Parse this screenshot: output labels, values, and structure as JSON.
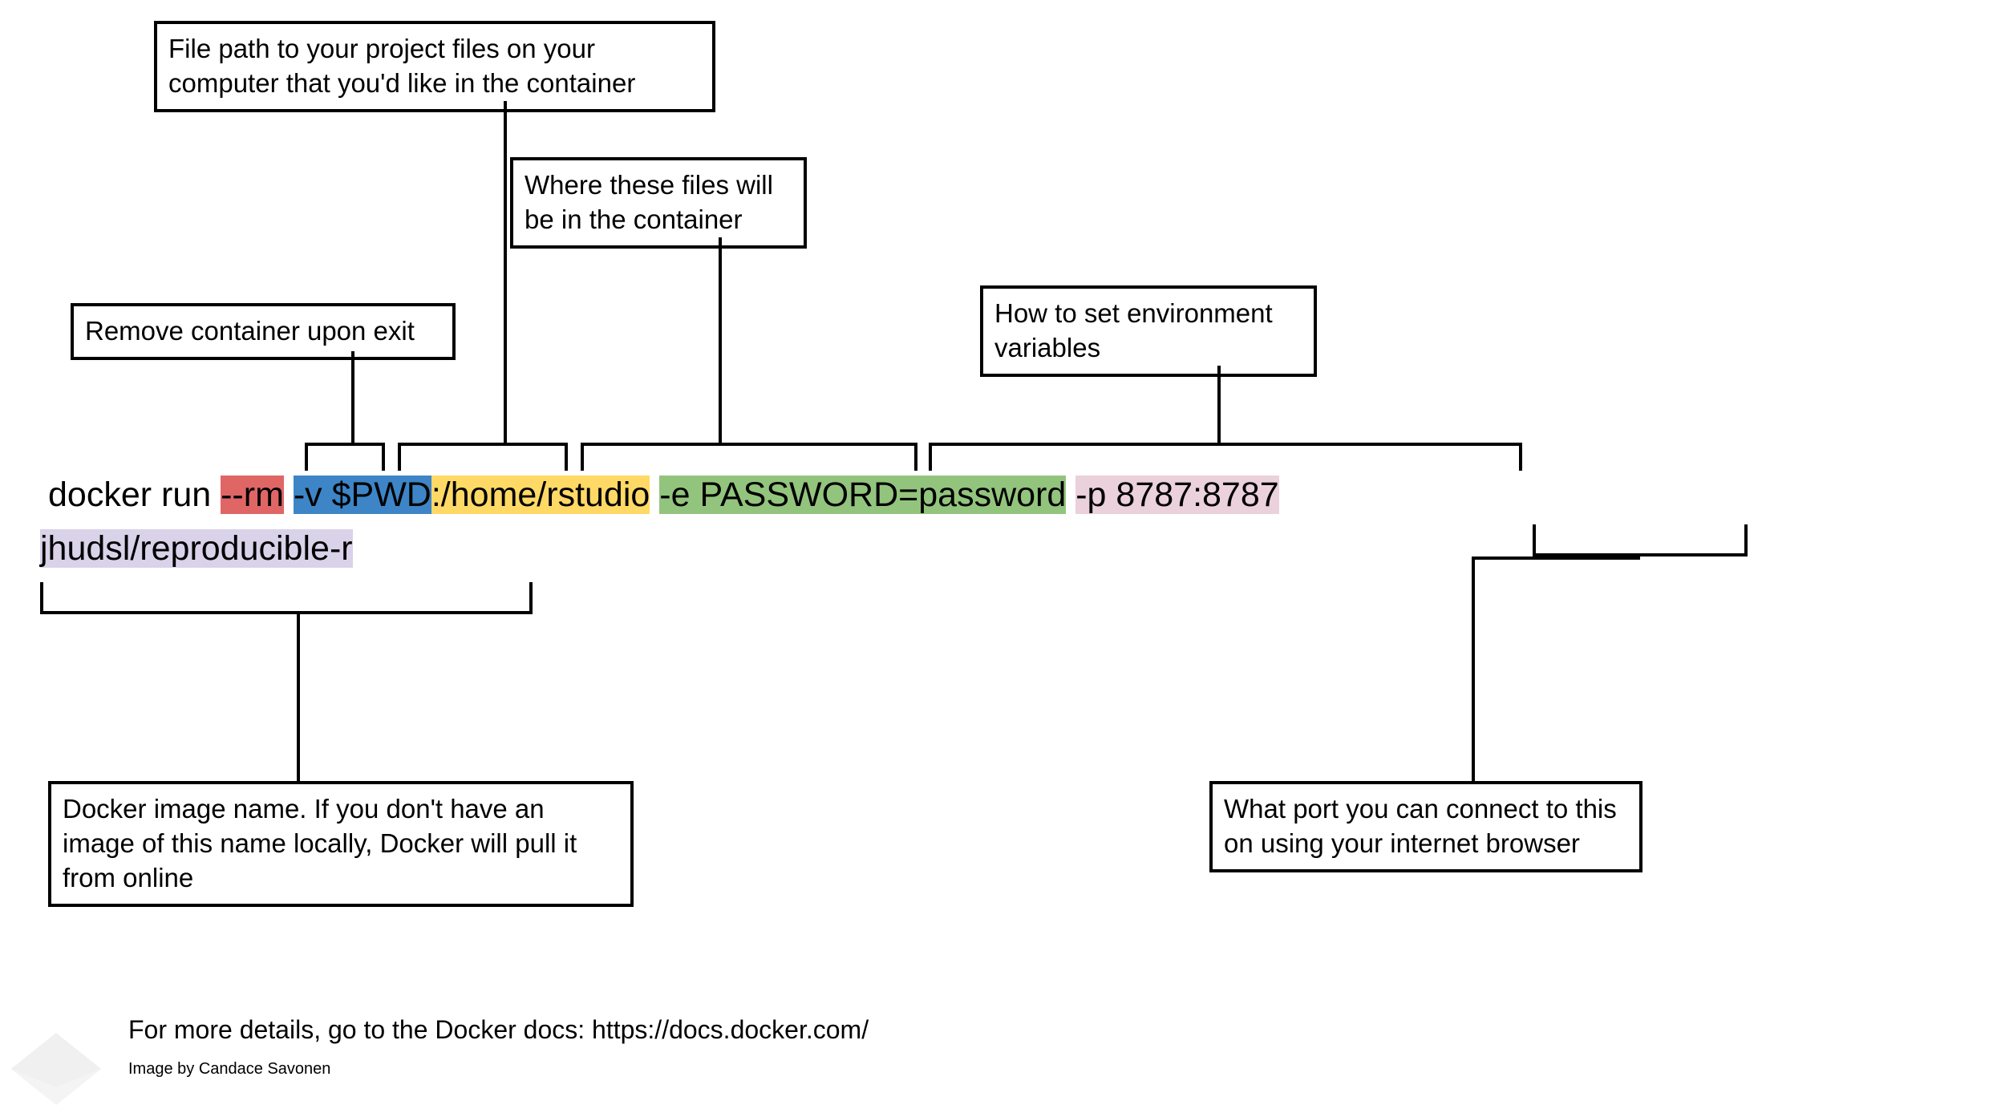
{
  "labels": {
    "filepath": "File path to your project files on your computer that you'd like in the container",
    "where": "Where these files will be in the container",
    "remove": "Remove container upon exit",
    "env": "How to set environment variables",
    "image": "Docker image name. If you don't have an image of this name locally, Docker will pull it from online",
    "port": "What port you can connect to this on using your internet browser"
  },
  "command": {
    "prefix": "docker run ",
    "rm": "--rm",
    "space1": " ",
    "vol_src": "-v $PWD",
    "vol_sep": ":",
    "vol_dst": "/home/rstudio",
    "space2": " ",
    "env": "-e PASSWORD=password",
    "space3": " ",
    "port": "-p 8787:8787",
    "image": "jhudsl/reproducible-r"
  },
  "footer": "For more details, go to the Docker docs: https://docs.docker.com/",
  "credit": "Image by Candace Savonen"
}
